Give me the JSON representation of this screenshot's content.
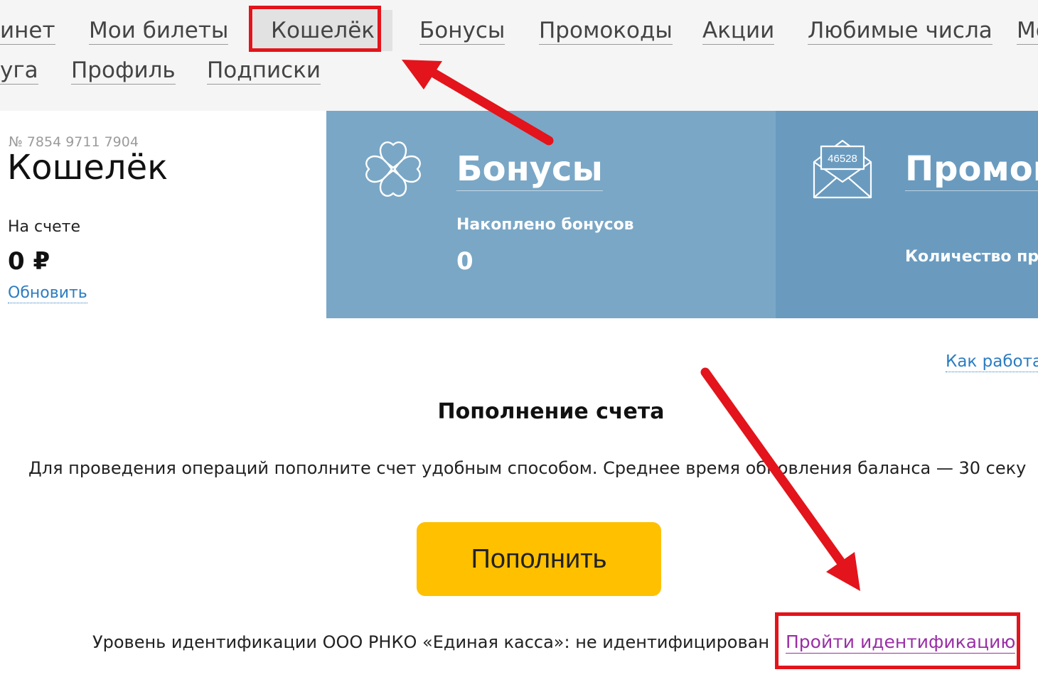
{
  "nav": {
    "row1": [
      "инет",
      "Мои билеты",
      "Кошелёк",
      "Бонусы",
      "Промокоды",
      "Акции",
      "Любимые числа",
      "Мо"
    ],
    "row2": [
      "уга",
      "Профиль",
      "Подписки"
    ],
    "active": "Кошелёк"
  },
  "wallet": {
    "account_number": "№ 7854 9711 7904",
    "title": "Кошелёк",
    "balance_label": "На счете",
    "balance": "0 ₽",
    "refresh": "Обновить"
  },
  "bonus_card": {
    "icon": "clover-icon",
    "title": "Бонусы",
    "label": "Накоплено бонусов",
    "value": "0"
  },
  "promo_card": {
    "icon": "envelope-icon",
    "envelope_code": "46528",
    "title": "Промок",
    "label": "Количество про"
  },
  "how_it_works": "Как работае",
  "topup": {
    "heading": "Пополнение счета",
    "description": "Для проведения операций пополните счет удобным способом. Среднее время обновления баланса — 30 секу",
    "button": "Пополнить"
  },
  "identification": {
    "text": "Уровень идентификации ООО РНКО «Единая касса»: не идентифицирован",
    "link": "Пройти идентификацию"
  },
  "colors": {
    "highlight": "#e3141b",
    "bonus_card": "#7aa7c6",
    "promo_card": "#6a9bbf",
    "button": "#ffc000",
    "link": "#2c7cc1",
    "ident_link": "#9a2fa6"
  }
}
